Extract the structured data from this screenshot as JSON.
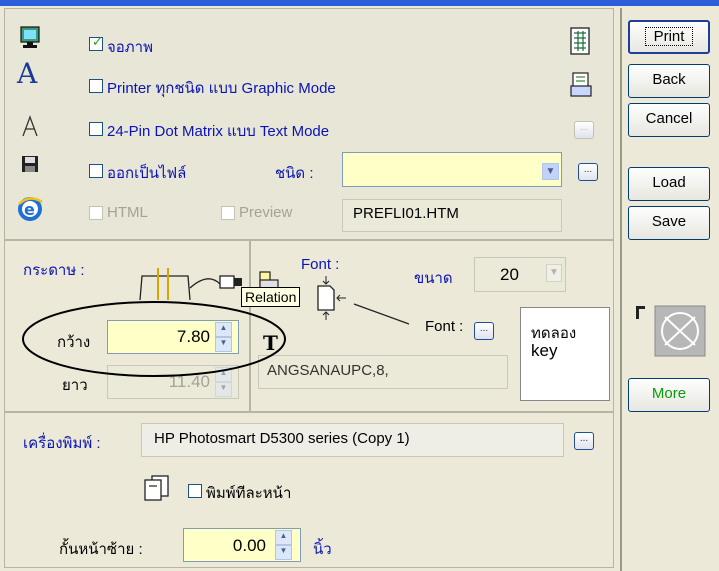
{
  "output": {
    "screen_label": "จอภาพ",
    "printer_graphic_label": "Printer ทุกชนิด แบบ Graphic Mode",
    "dot_matrix_label": "24-Pin Dot Matrix แบบ Text Mode",
    "file_label": "ออกเป็นไฟล์",
    "type_label": "ชนิด :",
    "html_label": "HTML",
    "preview_label": "Preview",
    "filename_value": "PREFLI01.HTM",
    "screen_checked": true
  },
  "paper": {
    "title": "กระดาษ :",
    "width_label": "กว้าง",
    "width_value": "7.80",
    "length_label": "ยาว",
    "length_value": "11.40",
    "tooltip": "Relation"
  },
  "font": {
    "title": "Font :",
    "size_label": "ขนาด",
    "size_value": "20",
    "font_button_label": "Font :",
    "font_value": "ANGSANAUPC,8,",
    "sample_line1": "ทดลอง",
    "sample_line2": "key"
  },
  "printer": {
    "label": "เครื่องพิมพ์ :",
    "name": "HP Photosmart D5300 series (Copy 1)",
    "per_page_label": "พิมพ์ทีละหน้า",
    "left_margin_label": "กั้นหน้าซ้าย :",
    "left_margin_value": "0.00",
    "unit": "นิ้ว"
  },
  "buttons": {
    "print": "Print",
    "back": "Back",
    "cancel": "Cancel",
    "load": "Load",
    "save": "Save",
    "more": "More"
  },
  "icons": {
    "ellipsis": "..."
  },
  "colors": {
    "accent_text": "#0a14b4",
    "field_yellow": "#ffffc8",
    "more_green": "#0a9a0a"
  }
}
